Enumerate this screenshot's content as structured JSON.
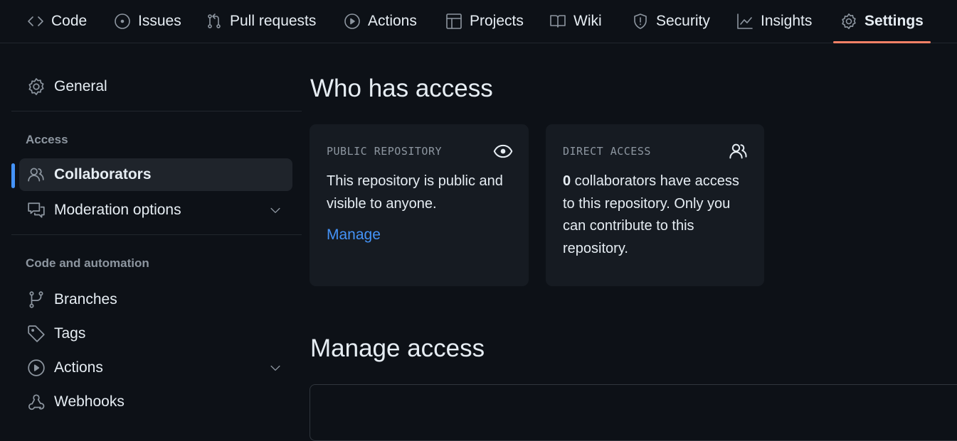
{
  "repo_nav": {
    "tabs": [
      {
        "label": "Code",
        "icon": "code-icon"
      },
      {
        "label": "Issues",
        "icon": "issue-opened-icon"
      },
      {
        "label": "Pull requests",
        "icon": "git-pull-request-icon"
      },
      {
        "label": "Actions",
        "icon": "play-icon"
      },
      {
        "label": "Projects",
        "icon": "table-icon"
      },
      {
        "label": "Wiki",
        "icon": "book-icon"
      },
      {
        "label": "Security",
        "icon": "shield-icon"
      },
      {
        "label": "Insights",
        "icon": "graph-icon"
      },
      {
        "label": "Settings",
        "icon": "gear-icon",
        "selected": true
      }
    ],
    "accent_color": "#f78166"
  },
  "sidebar": {
    "general": {
      "label": "General",
      "icon": "gear-icon"
    },
    "sections": [
      {
        "title": "Access",
        "items": [
          {
            "label": "Collaborators",
            "icon": "people-icon",
            "active": true
          },
          {
            "label": "Moderation options",
            "icon": "comment-discussion-icon",
            "expandable": true
          }
        ]
      },
      {
        "title": "Code and automation",
        "items": [
          {
            "label": "Branches",
            "icon": "git-branch-icon"
          },
          {
            "label": "Tags",
            "icon": "tag-icon"
          },
          {
            "label": "Actions",
            "icon": "play-icon",
            "expandable": true
          },
          {
            "label": "Webhooks",
            "icon": "webhook-icon"
          }
        ]
      }
    ],
    "active_indicator_color": "#4493f8"
  },
  "main": {
    "who_has_access": {
      "title": "Who has access",
      "public_card": {
        "label": "PUBLIC REPOSITORY",
        "icon": "eye-icon",
        "text": "This repository is public and visible to anyone.",
        "link": "Manage"
      },
      "direct_card": {
        "label": "DIRECT ACCESS",
        "icon": "people-icon",
        "count": "0",
        "text": " collaborators have access to this repository. Only you can contribute to this repository."
      }
    },
    "manage_access": {
      "title": "Manage access"
    }
  },
  "colors": {
    "background": "#0d1117",
    "card": "#161b22",
    "link": "#4493f8",
    "muted": "#8d96a0"
  }
}
